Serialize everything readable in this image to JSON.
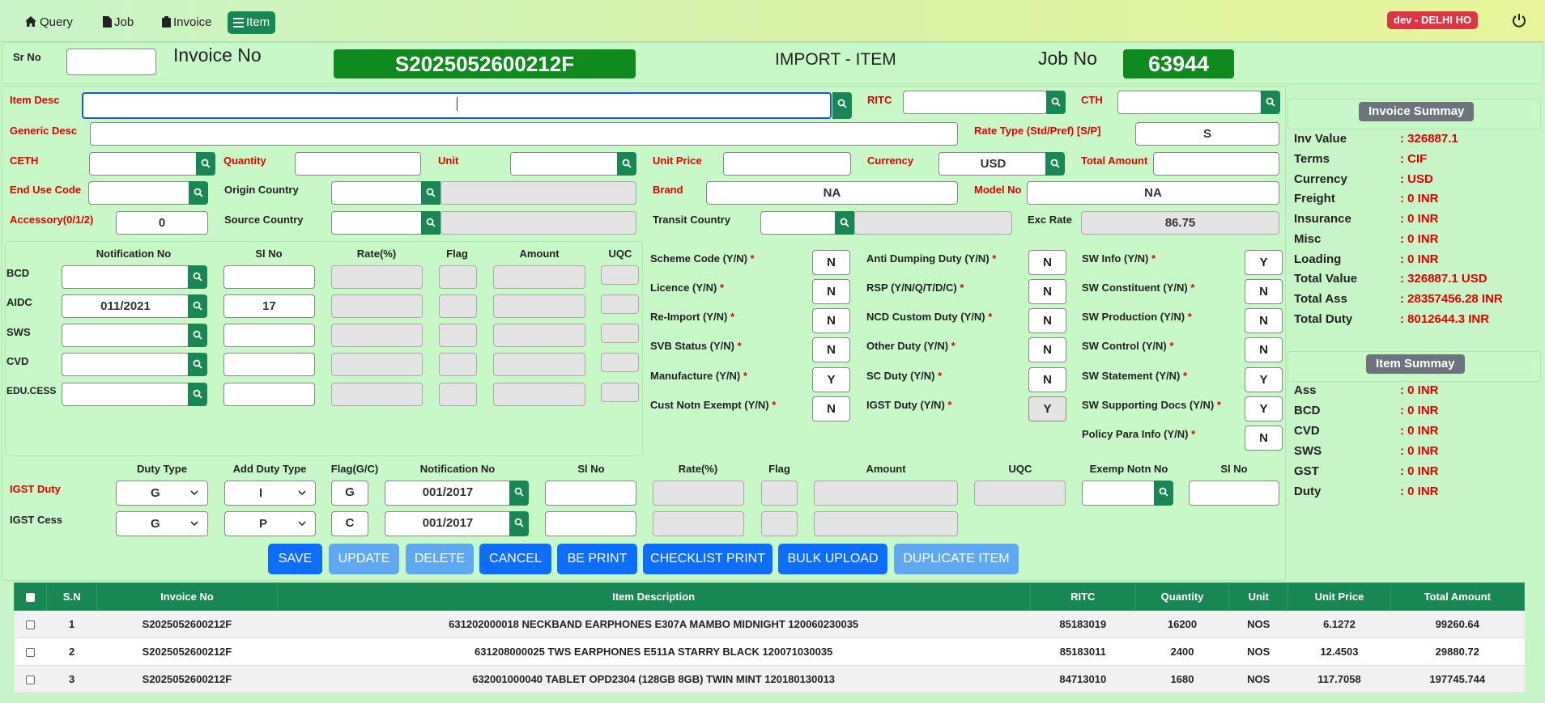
{
  "nav": {
    "items": [
      {
        "label": "Query",
        "icon": "home-icon"
      },
      {
        "label": "Job",
        "icon": "file-icon"
      },
      {
        "label": "Invoice",
        "icon": "clipboard-icon"
      },
      {
        "label": "Item",
        "icon": "list-icon"
      }
    ],
    "env": "dev - DELHI HO"
  },
  "header": {
    "sr_no_label": "Sr No",
    "sr_no_value": "",
    "invoice_no_label": "Invoice No",
    "invoice_no_value": "S2025052600212F",
    "title": "IMPORT - ITEM",
    "job_no_label": "Job No",
    "job_no_value": "63944"
  },
  "item": {
    "item_desc_label": "Item Desc",
    "item_desc_value": "",
    "ritc_label": "RITC",
    "ritc_value": "",
    "cth_label": "CTH",
    "cth_value": "",
    "generic_desc_label": "Generic Desc",
    "generic_desc_value": "",
    "rate_type_label": "Rate Type (Std/Pref) [S/P]",
    "rate_type_value": "S",
    "ceth_label": "CETH",
    "ceth_value": "",
    "quantity_label": "Quantity",
    "quantity_value": "",
    "unit_label": "Unit",
    "unit_value": "",
    "unit_price_label": "Unit Price",
    "unit_price_value": "",
    "currency_label": "Currency",
    "currency_value": "USD",
    "total_amount_label": "Total Amount",
    "total_amount_value": "",
    "end_use_label": "End Use Code",
    "end_use_value": "",
    "origin_country_label": "Origin Country",
    "origin_country_value": "",
    "brand_label": "Brand",
    "brand_value": "NA",
    "model_no_label": "Model No",
    "model_no_value": "NA",
    "accessory_label": "Accessory(0/1/2)",
    "accessory_value": "0",
    "source_country_label": "Source Country",
    "source_country_value": "",
    "transit_country_label": "Transit Country",
    "transit_country_value": "",
    "exc_rate_label": "Exc Rate",
    "exc_rate_value": "86.75"
  },
  "duty_grid": {
    "headers": [
      "Notification No",
      "Sl No",
      "Rate(%)",
      "Flag",
      "Amount",
      "UQC"
    ],
    "rows": [
      {
        "label": "BCD",
        "notification": "",
        "sl_no": ""
      },
      {
        "label": "AIDC",
        "notification": "011/2021",
        "sl_no": "17"
      },
      {
        "label": "SWS",
        "notification": "",
        "sl_no": ""
      },
      {
        "label": "CVD",
        "notification": "",
        "sl_no": ""
      },
      {
        "label": "EDU.CESS",
        "notification": "",
        "sl_no": ""
      }
    ]
  },
  "yn_fields": {
    "col1": [
      {
        "label": "Scheme Code (Y/N)",
        "value": "N"
      },
      {
        "label": "Licence (Y/N)",
        "value": "N"
      },
      {
        "label": "Re-Import (Y/N)",
        "value": "N"
      },
      {
        "label": "SVB Status (Y/N)",
        "value": "N"
      },
      {
        "label": "Manufacture (Y/N)",
        "value": "Y"
      },
      {
        "label": "Cust Notn Exempt (Y/N)",
        "value": "N"
      }
    ],
    "col2": [
      {
        "label": "Anti Dumping Duty (Y/N)",
        "value": "N"
      },
      {
        "label": "RSP (Y/N/Q/T/D/C)",
        "value": "N"
      },
      {
        "label": "NCD Custom Duty (Y/N)",
        "value": "N"
      },
      {
        "label": "Other Duty (Y/N)",
        "value": "N"
      },
      {
        "label": "SC Duty (Y/N)",
        "value": "N"
      },
      {
        "label": "IGST Duty (Y/N)",
        "value": "Y"
      }
    ],
    "col3": [
      {
        "label": "SW Info (Y/N)",
        "value": "Y"
      },
      {
        "label": "SW Constituent (Y/N)",
        "value": "N"
      },
      {
        "label": "SW Production (Y/N)",
        "value": "N"
      },
      {
        "label": "SW Control (Y/N)",
        "value": "N"
      },
      {
        "label": "SW Statement (Y/N)",
        "value": "Y"
      },
      {
        "label": "SW Supporting Docs (Y/N)",
        "value": "Y"
      },
      {
        "label": "Policy Para Info (Y/N)",
        "value": "N"
      }
    ],
    "required_mark": "*"
  },
  "igst": {
    "headers": [
      "Duty Type",
      "Add Duty Type",
      "Flag(G/C)",
      "Notification No",
      "Sl No",
      "Rate(%)",
      "Flag",
      "Amount",
      "UQC",
      "Exemp Notn No",
      "Sl No"
    ],
    "rows": [
      {
        "label": "IGST Duty",
        "duty_type": "G",
        "add_duty_type": "I",
        "flag": "G",
        "notification": "001/2017"
      },
      {
        "label": "IGST Cess",
        "duty_type": "G",
        "add_duty_type": "P",
        "flag": "C",
        "notification": "001/2017"
      }
    ]
  },
  "buttons": [
    {
      "label": "SAVE",
      "enabled": true
    },
    {
      "label": "UPDATE",
      "enabled": false
    },
    {
      "label": "DELETE",
      "enabled": false
    },
    {
      "label": "CANCEL",
      "enabled": true
    },
    {
      "label": "BE PRINT",
      "enabled": true
    },
    {
      "label": "CHECKLIST PRINT",
      "enabled": true
    },
    {
      "label": "BULK UPLOAD",
      "enabled": true
    },
    {
      "label": "DUPLICATE ITEM",
      "enabled": false
    }
  ],
  "invoice_summary": {
    "title": "Invoice Summay",
    "rows": [
      {
        "k": "Inv Value",
        "v": ": 326887.1"
      },
      {
        "k": "Terms",
        "v": ": CIF"
      },
      {
        "k": "Currency",
        "v": ": USD"
      },
      {
        "k": "Freight",
        "v": ": 0 INR"
      },
      {
        "k": "Insurance",
        "v": ": 0 INR"
      },
      {
        "k": "Misc",
        "v": ": 0 INR"
      },
      {
        "k": "Loading",
        "v": ": 0 INR"
      },
      {
        "k": "Total Value",
        "v": ": 326887.1 USD"
      },
      {
        "k": "Total Ass",
        "v": ": 28357456.28 INR"
      },
      {
        "k": "Total Duty",
        "v": ": 8012644.3 INR"
      }
    ]
  },
  "item_summary": {
    "title": "Item Summay",
    "rows": [
      {
        "k": "Ass",
        "v": ": 0 INR"
      },
      {
        "k": "BCD",
        "v": ": 0 INR"
      },
      {
        "k": "CVD",
        "v": ": 0 INR"
      },
      {
        "k": "SWS",
        "v": ": 0 INR"
      },
      {
        "k": "GST",
        "v": ": 0 INR"
      },
      {
        "k": "Duty",
        "v": ": 0 INR"
      }
    ]
  },
  "table": {
    "headers": [
      "S.N",
      "Invoice No",
      "Item Description",
      "RITC",
      "Quantity",
      "Unit",
      "Unit Price",
      "Total Amount"
    ],
    "rows": [
      [
        "1",
        "S2025052600212F",
        "631202000018 NECKBAND EARPHONES E307A MAMBO MIDNIGHT 120060230035",
        "85183019",
        "16200",
        "NOS",
        "6.1272",
        "99260.64"
      ],
      [
        "2",
        "S2025052600212F",
        "631208000025 TWS EARPHONES E511A STARRY BLACK 120071030035",
        "85183011",
        "2400",
        "NOS",
        "12.4503",
        "29880.72"
      ],
      [
        "3",
        "S2025052600212F",
        "632001000040 TABLET OPD2304 (128GB 8GB) TWIN MINT 120180130013",
        "84713010",
        "1680",
        "NOS",
        "117.7058",
        "197745.744"
      ]
    ]
  },
  "colors": {
    "accent_green": "#198754",
    "required_red": "#e00000",
    "primary_blue": "#0d6efd"
  }
}
